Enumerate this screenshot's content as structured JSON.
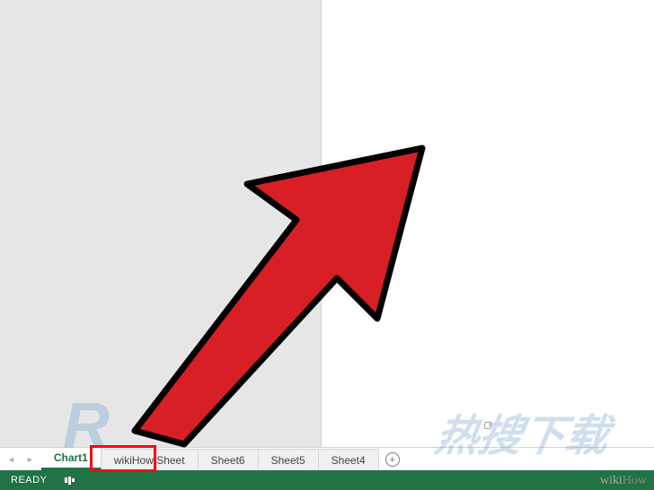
{
  "tabs": {
    "items": [
      {
        "label": "Chart1",
        "active": true
      },
      {
        "label": "wikiHow Sheet",
        "active": false
      },
      {
        "label": "Sheet6",
        "active": false
      },
      {
        "label": "Sheet5",
        "active": false
      },
      {
        "label": "Sheet4",
        "active": false
      }
    ]
  },
  "status": {
    "label": "READY"
  },
  "watermarks": {
    "wikihow_prefix": "wiki",
    "wikihow_suffix": "How",
    "cn_text": "热搜下载",
    "cn_R": "R"
  }
}
